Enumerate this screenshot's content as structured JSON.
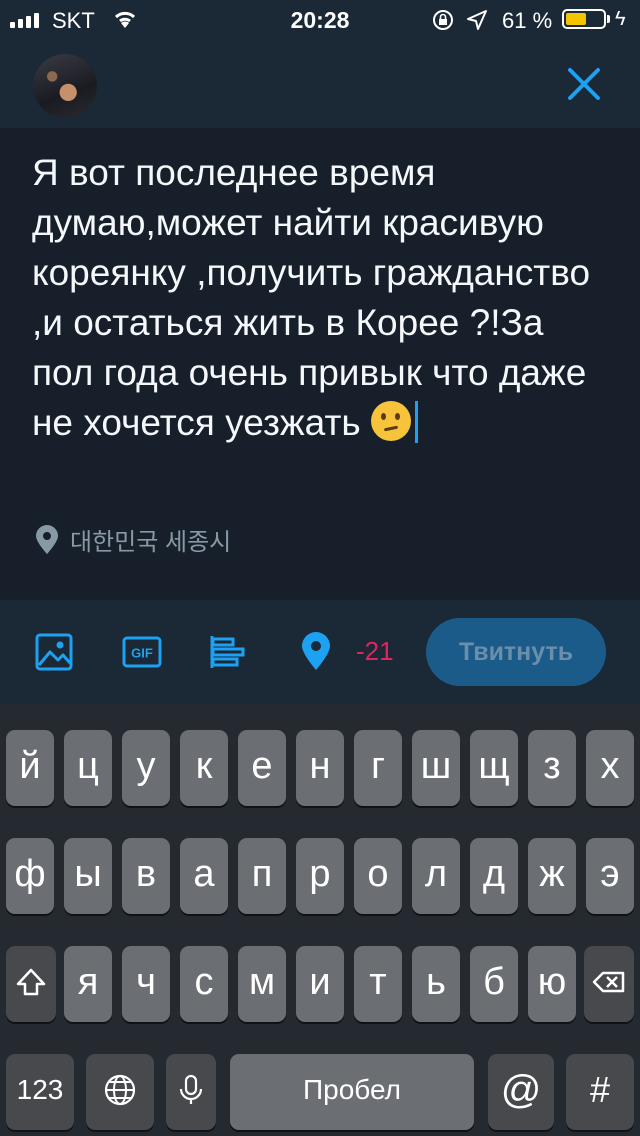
{
  "status_bar": {
    "carrier": "SKT",
    "time": "20:28",
    "battery_percent": "61 %",
    "battery_level": 0.61
  },
  "header": {
    "close_icon": "close-icon",
    "accent": "#1da1f2"
  },
  "compose": {
    "text": "Я вот последнее время думаю,может найти красивую кореянку ,получить гражданство ,и остаться жить в Корее ?!За пол года очень привык что даже не хочется уезжать",
    "emoji": "thinking-face-emoji",
    "location": "대한민국 세종시"
  },
  "toolbar": {
    "icons": [
      "image-icon",
      "gif-icon",
      "poll-icon",
      "location-pin-icon"
    ],
    "gif_label": "GIF",
    "char_counter": "-21",
    "tweet_button": "Твитнуть"
  },
  "keyboard": {
    "row1": [
      "й",
      "ц",
      "у",
      "к",
      "е",
      "н",
      "г",
      "ш",
      "щ",
      "з",
      "х"
    ],
    "row2": [
      "ф",
      "ы",
      "в",
      "а",
      "п",
      "р",
      "о",
      "л",
      "д",
      "ж",
      "э"
    ],
    "row3": [
      "я",
      "ч",
      "с",
      "м",
      "и",
      "т",
      "ь",
      "б",
      "ю"
    ],
    "numbers_key": "123",
    "space_key": "Пробел",
    "at_key": "@",
    "hash_key": "#"
  }
}
